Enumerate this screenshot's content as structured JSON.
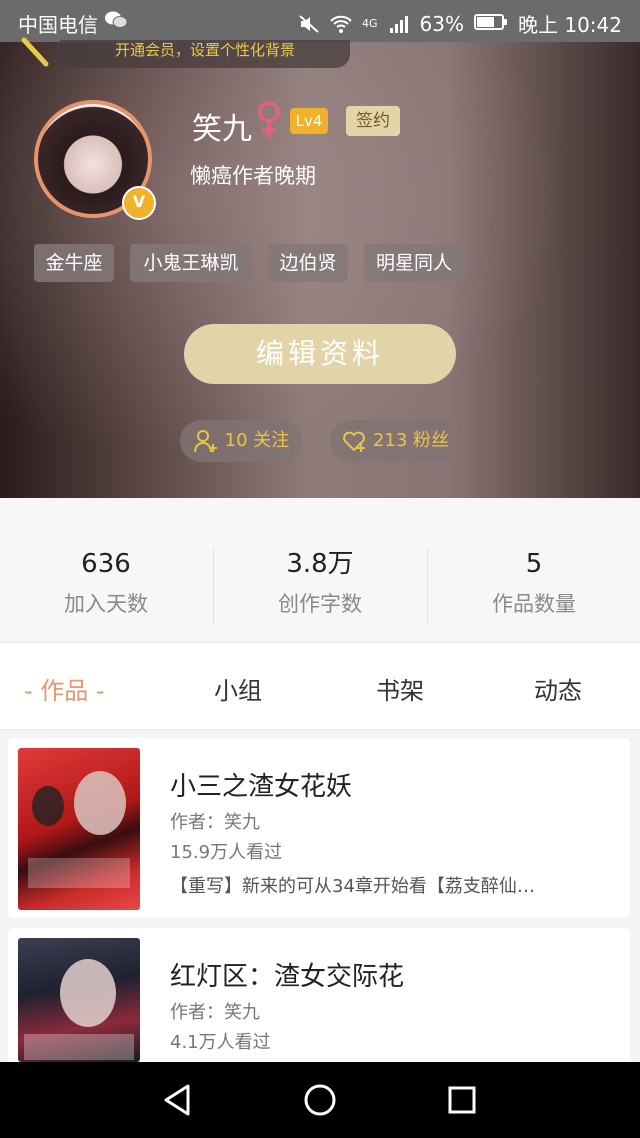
{
  "status_bar": {
    "carrier": "中国电信",
    "battery": "63%",
    "time": "晚上 10:42",
    "network": "4G"
  },
  "vip_banner": "开通会员，设置个性化背景",
  "profile": {
    "name": "笑九",
    "level": "Lv4",
    "signed": "签约",
    "bio": "懒癌作者晚期",
    "verified_badge": "V",
    "tags": [
      "金牛座",
      "小鬼王琳凯",
      "边伯贤",
      "明星同人"
    ],
    "edit_button": "编辑资料",
    "following": "10 关注",
    "followers": "213 粉丝"
  },
  "stats": [
    {
      "value": "636",
      "label": "加入天数"
    },
    {
      "value": "3.8万",
      "label": "创作字数"
    },
    {
      "value": "5",
      "label": "作品数量"
    }
  ],
  "tabs": [
    "- 作品 -",
    "小组",
    "书架",
    "动态"
  ],
  "works": [
    {
      "title": "小三之渣女花妖",
      "author": "作者：笑九",
      "views": "15.9万人看过",
      "desc": "【重写】新来的可从34章开始看【荔支醉仙…"
    },
    {
      "title": "红灯区：渣女交际花",
      "author": "作者：笑九",
      "views": "4.1万人看过",
      "desc": ""
    }
  ],
  "colors": {
    "accent": "#e8966e",
    "gold": "#f0b22a",
    "edit_button": "#e3d3a8"
  }
}
